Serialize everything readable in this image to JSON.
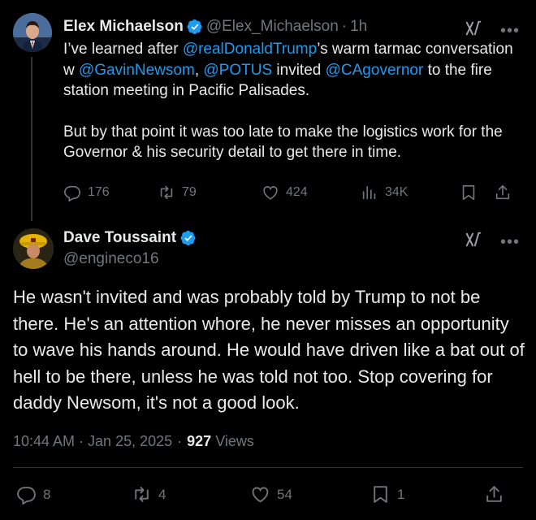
{
  "parent_tweet": {
    "display_name": "Elex Michaelson",
    "handle": "@Elex_Michaelson",
    "separator": "·",
    "time": "1h",
    "body": {
      "line1_pre": "I’ve learned after ",
      "mention_trump": "@realDonaldTrump",
      "line1_post": "’s warm tarmac conversation w ",
      "mention_newsom": "@GavinNewsom",
      "comma": ", ",
      "mention_potus": "@POTUS",
      "invited": " invited ",
      "mention_cagov": "@CAgovernor",
      "line_end": " to the fire station meeting in Pacific Palisades.",
      "para2": "But by that point it was too late to make the logistics work for the Governor & his security detail to get there in time."
    },
    "stats": {
      "replies": "176",
      "reposts": "79",
      "likes": "424",
      "views": "34K"
    }
  },
  "main_tweet": {
    "display_name": "Dave Toussaint",
    "handle": "@engineco16",
    "body": "He wasn't invited and was probably told by Trump to not be there. He's an attention whore, he never misses an opportunity to wave his hands around. He would have driven like a bat out of hell to be there, unless he was told not too. Stop covering for daddy Newsom, it's not a good look.",
    "timestamp": "10:44 AM · Jan 25, 2025",
    "meta_sep": "·",
    "views_count": "927",
    "views_label": "Views",
    "stats": {
      "replies": "8",
      "reposts": "4",
      "likes": "54",
      "bookmarks": "1"
    }
  },
  "colors": {
    "background": "#000000",
    "accent": "#1d9bf0",
    "text": "#e7e9ea",
    "muted": "#71767b"
  },
  "icons": [
    "verified-badge-icon",
    "grok-icon",
    "more-icon",
    "reply-icon",
    "repost-icon",
    "like-icon",
    "views-icon",
    "bookmark-icon",
    "share-icon"
  ]
}
